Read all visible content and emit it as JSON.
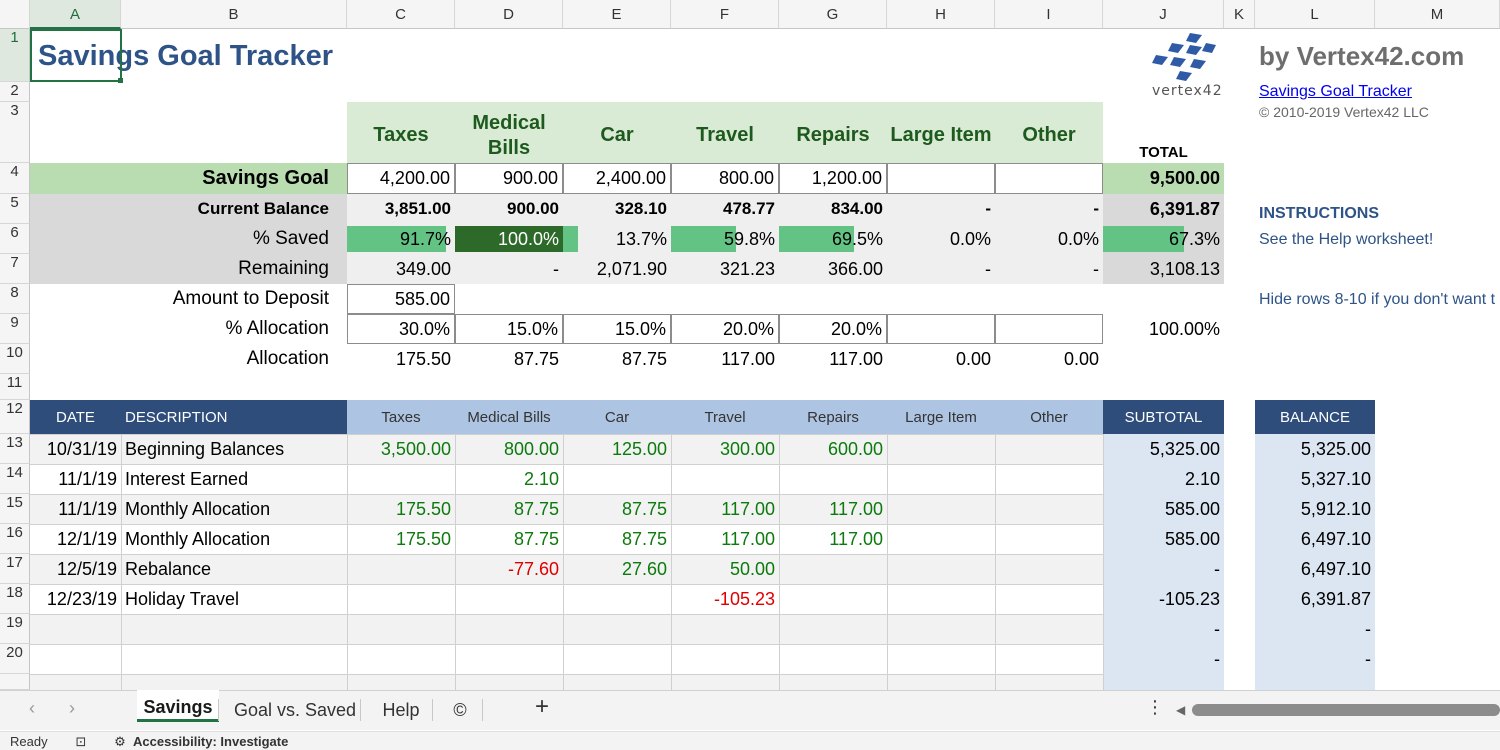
{
  "columns": [
    "A",
    "B",
    "C",
    "D",
    "E",
    "F",
    "G",
    "H",
    "I",
    "J",
    "K",
    "L",
    "M"
  ],
  "rows": [
    "1",
    "2",
    "3",
    "4",
    "5",
    "6",
    "7",
    "8",
    "9",
    "10",
    "11",
    "12",
    "13",
    "14",
    "15",
    "16",
    "17",
    "18",
    "19",
    "20"
  ],
  "title": "Savings Goal Tracker",
  "branding": {
    "by_line": "by Vertex42.com",
    "logo_text": "vertex42",
    "link_text": "Savings Goal Tracker",
    "copyright": "© 2010-2019 Vertex42 LLC",
    "instructions_heading": "INSTRUCTIONS",
    "instructions_text": "See the Help worksheet!",
    "hide_rows_note": "Hide rows 8-10 if you don't want t"
  },
  "categories": [
    "Taxes",
    "Medical Bills",
    "Car",
    "Travel",
    "Repairs",
    "Large Item",
    "Other"
  ],
  "category_header_lines": [
    [
      "Taxes"
    ],
    [
      "Medical",
      "Bills"
    ],
    [
      "Car"
    ],
    [
      "Travel"
    ],
    [
      "Repairs"
    ],
    [
      "Large Item"
    ],
    [
      "Other"
    ]
  ],
  "total_label": "TOTAL",
  "summary": {
    "savings_goal": {
      "label": "Savings Goal",
      "values": [
        "4,200.00",
        "900.00",
        "2,400.00",
        "800.00",
        "1,200.00",
        "",
        ""
      ],
      "total": "9,500.00"
    },
    "current_balance": {
      "label": "Current Balance",
      "values": [
        "3,851.00",
        "900.00",
        "328.10",
        "478.77",
        "834.00",
        "-",
        "-"
      ],
      "total": "6,391.87"
    },
    "pct_saved": {
      "label": "% Saved",
      "values": [
        "91.7%",
        "100.0%",
        "13.7%",
        "59.8%",
        "69.5%",
        "0.0%",
        "0.0%"
      ],
      "fractions": [
        0.917,
        1.0,
        0.137,
        0.598,
        0.695,
        0,
        0
      ],
      "total": "67.3%",
      "total_fraction": 0.673
    },
    "remaining": {
      "label": "Remaining",
      "values": [
        "349.00",
        "-",
        "2,071.90",
        "321.23",
        "366.00",
        "-",
        "-"
      ],
      "total": "3,108.13"
    },
    "amount_to_deposit": {
      "label": "Amount to Deposit",
      "value": "585.00"
    },
    "pct_allocation": {
      "label": "% Allocation",
      "values": [
        "30.0%",
        "15.0%",
        "15.0%",
        "20.0%",
        "20.0%",
        "",
        ""
      ],
      "total": "100.00%"
    },
    "allocation": {
      "label": "Allocation",
      "values": [
        "175.50",
        "87.75",
        "87.75",
        "117.00",
        "117.00",
        "0.00",
        "0.00"
      ]
    }
  },
  "register": {
    "headers": {
      "date": "DATE",
      "description": "DESCRIPTION",
      "subtotal": "SUBTOTAL",
      "balance": "BALANCE"
    },
    "rows": [
      {
        "date": "10/31/19",
        "description": "Beginning Balances",
        "values": [
          "3,500.00",
          "800.00",
          "125.00",
          "300.00",
          "600.00",
          "",
          ""
        ],
        "subtotal": "5,325.00",
        "balance": "5,325.00"
      },
      {
        "date": "11/1/19",
        "description": "Interest Earned",
        "values": [
          "",
          "2.10",
          "",
          "",
          "",
          "",
          ""
        ],
        "subtotal": "2.10",
        "balance": "5,327.10"
      },
      {
        "date": "11/1/19",
        "description": "Monthly Allocation",
        "values": [
          "175.50",
          "87.75",
          "87.75",
          "117.00",
          "117.00",
          "",
          ""
        ],
        "subtotal": "585.00",
        "balance": "5,912.10"
      },
      {
        "date": "12/1/19",
        "description": "Monthly Allocation",
        "values": [
          "175.50",
          "87.75",
          "87.75",
          "117.00",
          "117.00",
          "",
          ""
        ],
        "subtotal": "585.00",
        "balance": "6,497.10"
      },
      {
        "date": "12/5/19",
        "description": "Rebalance",
        "values": [
          "",
          "-77.60",
          "27.60",
          "50.00",
          "",
          "",
          ""
        ],
        "subtotal": "-",
        "balance": "6,497.10"
      },
      {
        "date": "12/23/19",
        "description": "Holiday Travel",
        "values": [
          "",
          "",
          "",
          "-105.23",
          "",
          "",
          ""
        ],
        "subtotal": "-105.23",
        "balance": "6,391.87"
      },
      {
        "date": "",
        "description": "",
        "values": [
          "",
          "",
          "",
          "",
          "",
          "",
          ""
        ],
        "subtotal": "-",
        "balance": "-"
      },
      {
        "date": "",
        "description": "",
        "values": [
          "",
          "",
          "",
          "",
          "",
          "",
          ""
        ],
        "subtotal": "-",
        "balance": "-"
      }
    ]
  },
  "sheet_tabs": [
    "Savings",
    "Goal vs. Saved",
    "Help",
    "©"
  ],
  "active_tab": "Savings",
  "add_sheet": "+",
  "status_bar": {
    "ready": "Ready",
    "accessibility": "Accessibility: Investigate"
  },
  "colors": {
    "title_blue": "#2e5387",
    "category_bg": "#d9ebd5",
    "category_text": "#1e5a1e",
    "goal_row_bg": "#b9dcb1",
    "grey_bg": "#d9d9d9",
    "progress_light": "#63c384",
    "progress_dark": "#2d6a2a",
    "header_navy": "#2e4d7b",
    "header_light": "#adc4e2",
    "subtotal_bg": "#dce6f2",
    "positive_green": "#0d7a0d",
    "negative_red": "#e00000"
  }
}
